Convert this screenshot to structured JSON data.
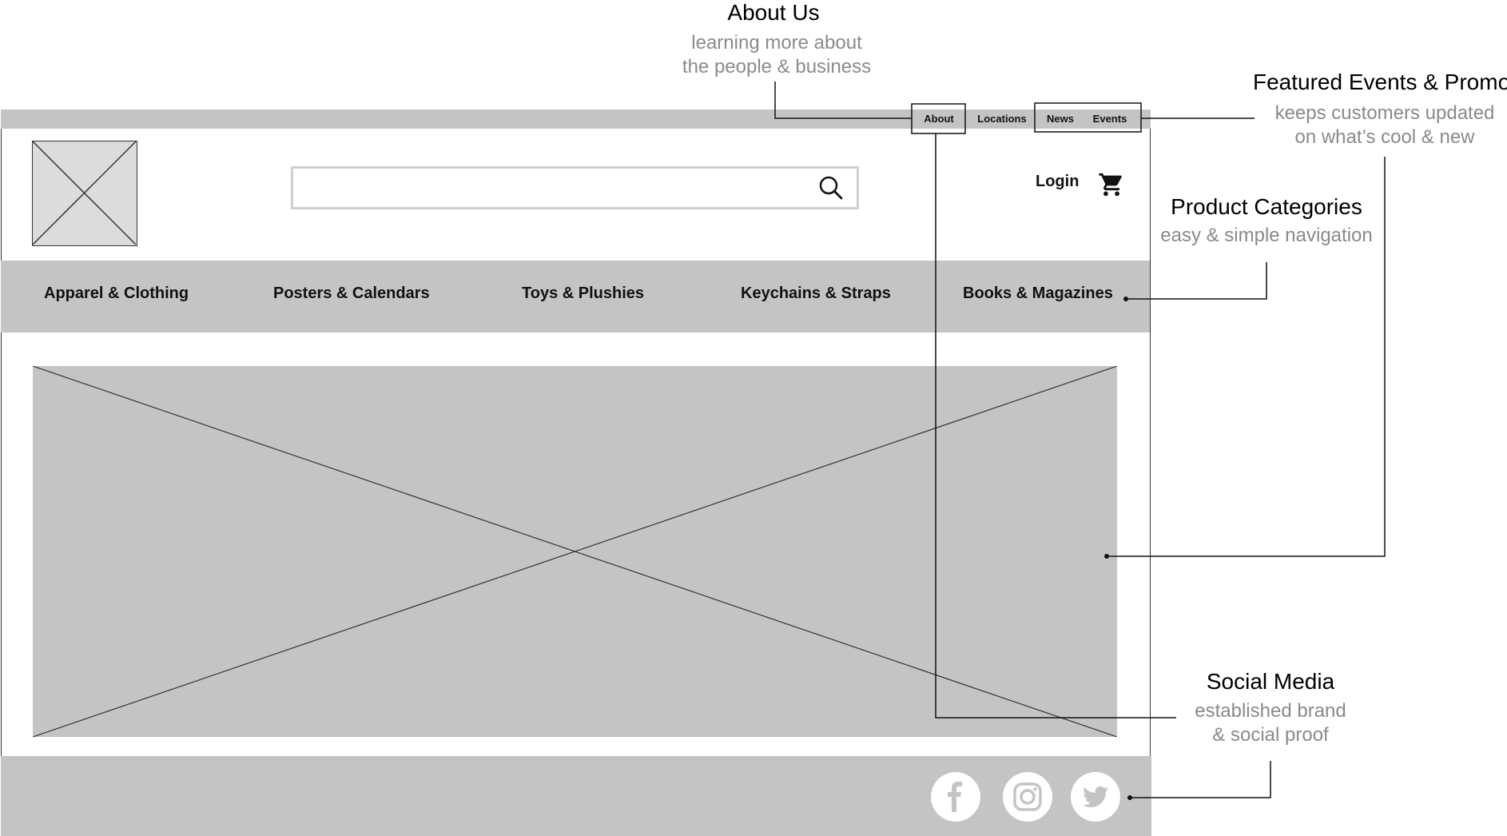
{
  "utility_nav": {
    "about": "About",
    "locations": "Locations",
    "news": "News",
    "events": "Events"
  },
  "header": {
    "logo_icon": "image-placeholder-icon",
    "search_icon": "search-icon",
    "login": "Login",
    "cart_icon": "shopping-cart-icon"
  },
  "categories": [
    "Apparel & Clothing",
    "Posters & Calendars",
    "Toys & Plushies",
    "Keychains & Straps",
    "Books & Magazines"
  ],
  "hero": {
    "icon": "image-placeholder-icon"
  },
  "footer": {
    "social_icons": [
      "facebook-icon",
      "instagram-icon",
      "twitter-icon"
    ]
  },
  "annotations": {
    "about_us": {
      "title": "About Us",
      "sub1": "learning more about",
      "sub2": "the people & business"
    },
    "featured": {
      "title": "Featured Events & Promos",
      "sub1": "keeps customers updated",
      "sub2": "on what’s cool & new"
    },
    "categories": {
      "title": "Product Categories",
      "sub1": "easy & simple navigation"
    },
    "social": {
      "title": "Social Media",
      "sub1": "established brand",
      "sub2": "& social proof"
    }
  },
  "colors": {
    "wire_gray": "#c4c4c4",
    "annotation_gray": "#8a8a8a"
  }
}
